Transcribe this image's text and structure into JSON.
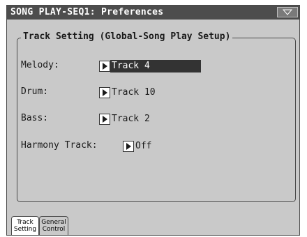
{
  "title": "SONG PLAY-SEQ1: Preferences",
  "group_title": "Track Setting (Global-Song Play Setup)",
  "settings": [
    {
      "label": "Melody:",
      "value": "Track 4",
      "selected": true
    },
    {
      "label": "Drum:",
      "value": "Track 10",
      "selected": false
    },
    {
      "label": "Bass:",
      "value": "Track 2",
      "selected": false
    },
    {
      "label": "Harmony Track:",
      "value": "Off",
      "selected": false
    }
  ],
  "tabs": [
    {
      "line1": "Track",
      "line2": "Setting",
      "active": true
    },
    {
      "line1": "General",
      "line2": "Control",
      "active": false
    }
  ],
  "colors": {
    "title_bar": "#4d4d4d",
    "panel": "#c9c9c9",
    "selected": "#333333"
  },
  "icons": {
    "menu": "menu-triangle-icon",
    "popup": "play-arrow-icon"
  }
}
